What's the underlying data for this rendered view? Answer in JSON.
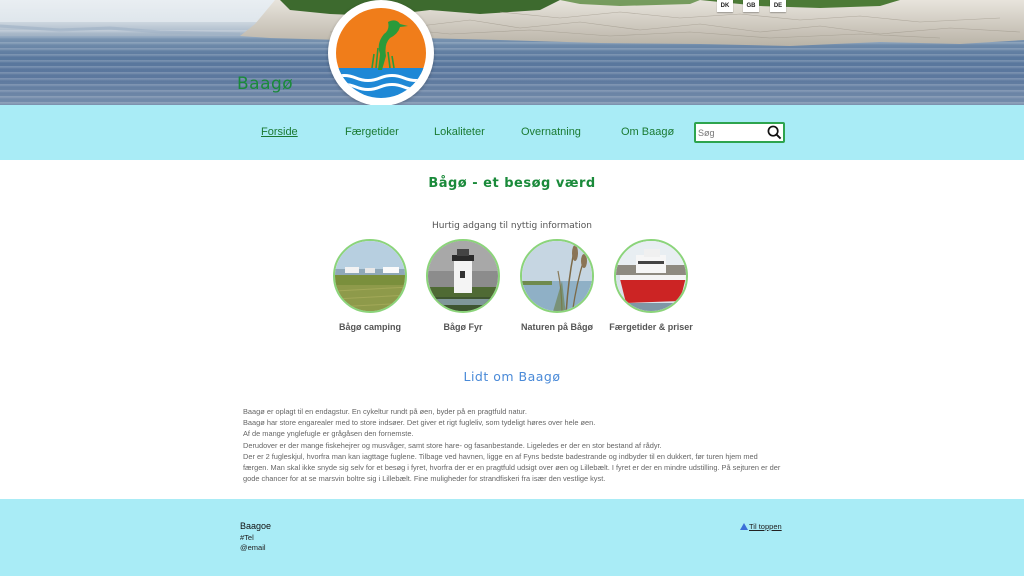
{
  "header": {
    "brand": "Baagø",
    "languages": [
      "DK",
      "GB",
      "DE"
    ]
  },
  "nav": {
    "items": [
      {
        "label": "Forside",
        "active": true
      },
      {
        "label": "Færgetider",
        "active": false
      },
      {
        "label": "Lokaliteter",
        "active": false
      },
      {
        "label": "Overnatning",
        "active": false
      },
      {
        "label": "Om Baagø",
        "active": false
      }
    ],
    "search_placeholder": "Søg",
    "search_icon": "magnifier-icon"
  },
  "main": {
    "title": "Bågø - et besøg værd",
    "quick_heading": "Hurtig adgang til nyttig information",
    "cards": [
      {
        "label": "Bågø camping"
      },
      {
        "label": "Bågø Fyr"
      },
      {
        "label": "Naturen på Bågø"
      },
      {
        "label": "Færgetider & priser"
      }
    ],
    "about_title": "Lidt om Baagø",
    "about_lines": [
      "Baagø er oplagt til en endagstur. En cykeltur rundt på øen, byder på en pragtfuld natur.",
      "Baagø har store engarealer med to store indsøer. Det giver et rigt fugleliv, som tydeligt høres over hele øen.",
      "Af de mange ynglefugle er grågåsen den fornemste.",
      "Derudover er der mange fiskehejrer og musvåger, samt store hare- og fasanbestande. Ligeledes er der en stor bestand af rådyr.",
      "Der er 2 fugleskjul, hvorfra man kan iagttage fuglene. Tilbage ved havnen, ligge en af Fyns bedste badestrande og indbyder til en dukkert, før turen hjem med færgen. Man skal ikke snyde sig selv for et besøg i fyret, hvorfra der er en pragtfuld udsigt over øen og Lillebælt. I fyret er der en mindre udstilling. På sejturen er der gode chancer for at se marsvin boltre sig i Lillebælt. Fine muligheder for strandfiskeri fra især den vestlige kyst."
    ]
  },
  "footer": {
    "name": "Baagoe",
    "tel": "#Tel",
    "email": "@email",
    "to_top": "Til toppen"
  },
  "colors": {
    "nav_bg": "#a9ecf6",
    "brand_green": "#1a8a3a",
    "accent_blue": "#4a8ad8",
    "logo_orange": "#f07d1a",
    "logo_blue": "#1e88d6"
  }
}
